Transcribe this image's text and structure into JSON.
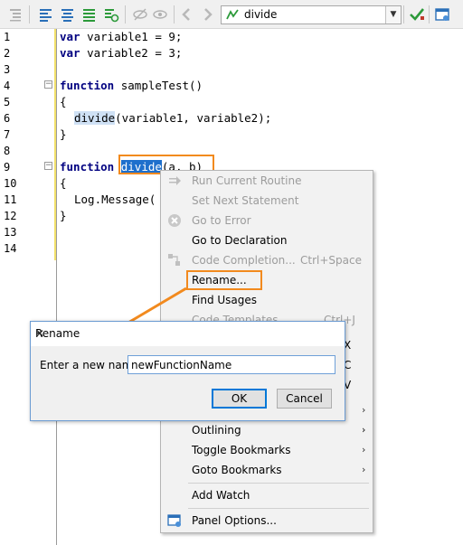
{
  "toolbar": {
    "routine_select": "divide",
    "icons": [
      "indent-icon",
      "align-left-icon",
      "align-center-icon",
      "align-justify-icon",
      "step-icon",
      "hide-icon",
      "show-icon",
      "back-arrow-icon",
      "forward-arrow-icon",
      "check-icon",
      "panel-icon"
    ]
  },
  "editor": {
    "line_numbers": [
      "1",
      "2",
      "3",
      "4",
      "5",
      "6",
      "7",
      "8",
      "9",
      "10",
      "11",
      "12",
      "13",
      "14"
    ],
    "lines": {
      "l1_kw": "var",
      "l1_rest": " variable1 = 9;",
      "l2_kw": "var",
      "l2_rest": " variable2 = 3;",
      "l4_kw": "function",
      "l4_rest": " sampleTest()",
      "l5": "{",
      "l6_call": "divide",
      "l6_rest": "(variable1, variable2);",
      "l7": "}",
      "l9_kw": "function",
      "l9_sel": "divide",
      "l9_rest": "(a, b)",
      "l10": "{",
      "l11_obj": "Log",
      "l11_rest": ".Message(",
      "l12": "}"
    }
  },
  "context_menu": {
    "items": {
      "run_current_routine": "Run Current Routine",
      "set_next_statement": "Set Next Statement",
      "go_to_error": "Go to Error",
      "go_to_declaration": "Go to Declaration",
      "code_completion": "Code Completion...",
      "code_completion_shortcut": "Ctrl+Space",
      "rename": "Rename...",
      "find_usages": "Find Usages",
      "code_templates": "Code Templates",
      "code_templates_shortcut": "Ctrl+J",
      "cut_shortcut_fragment": "X",
      "copy_shortcut_fragment": "C",
      "paste_shortcut_fragment": "V",
      "outlining": "Outlining",
      "toggle_bookmarks": "Toggle Bookmarks",
      "goto_bookmarks": "Goto Bookmarks",
      "add_watch": "Add Watch",
      "panel_options": "Panel Options..."
    }
  },
  "dialog": {
    "title": "Rename",
    "close": "✕",
    "prompt": "Enter a new name:",
    "input_value": "newFunctionName",
    "ok": "OK",
    "cancel": "Cancel"
  },
  "colors": {
    "highlight_orange": "#f28a1e",
    "keyword_blue": "#000080",
    "selection_blue": "#1e6fcc"
  }
}
